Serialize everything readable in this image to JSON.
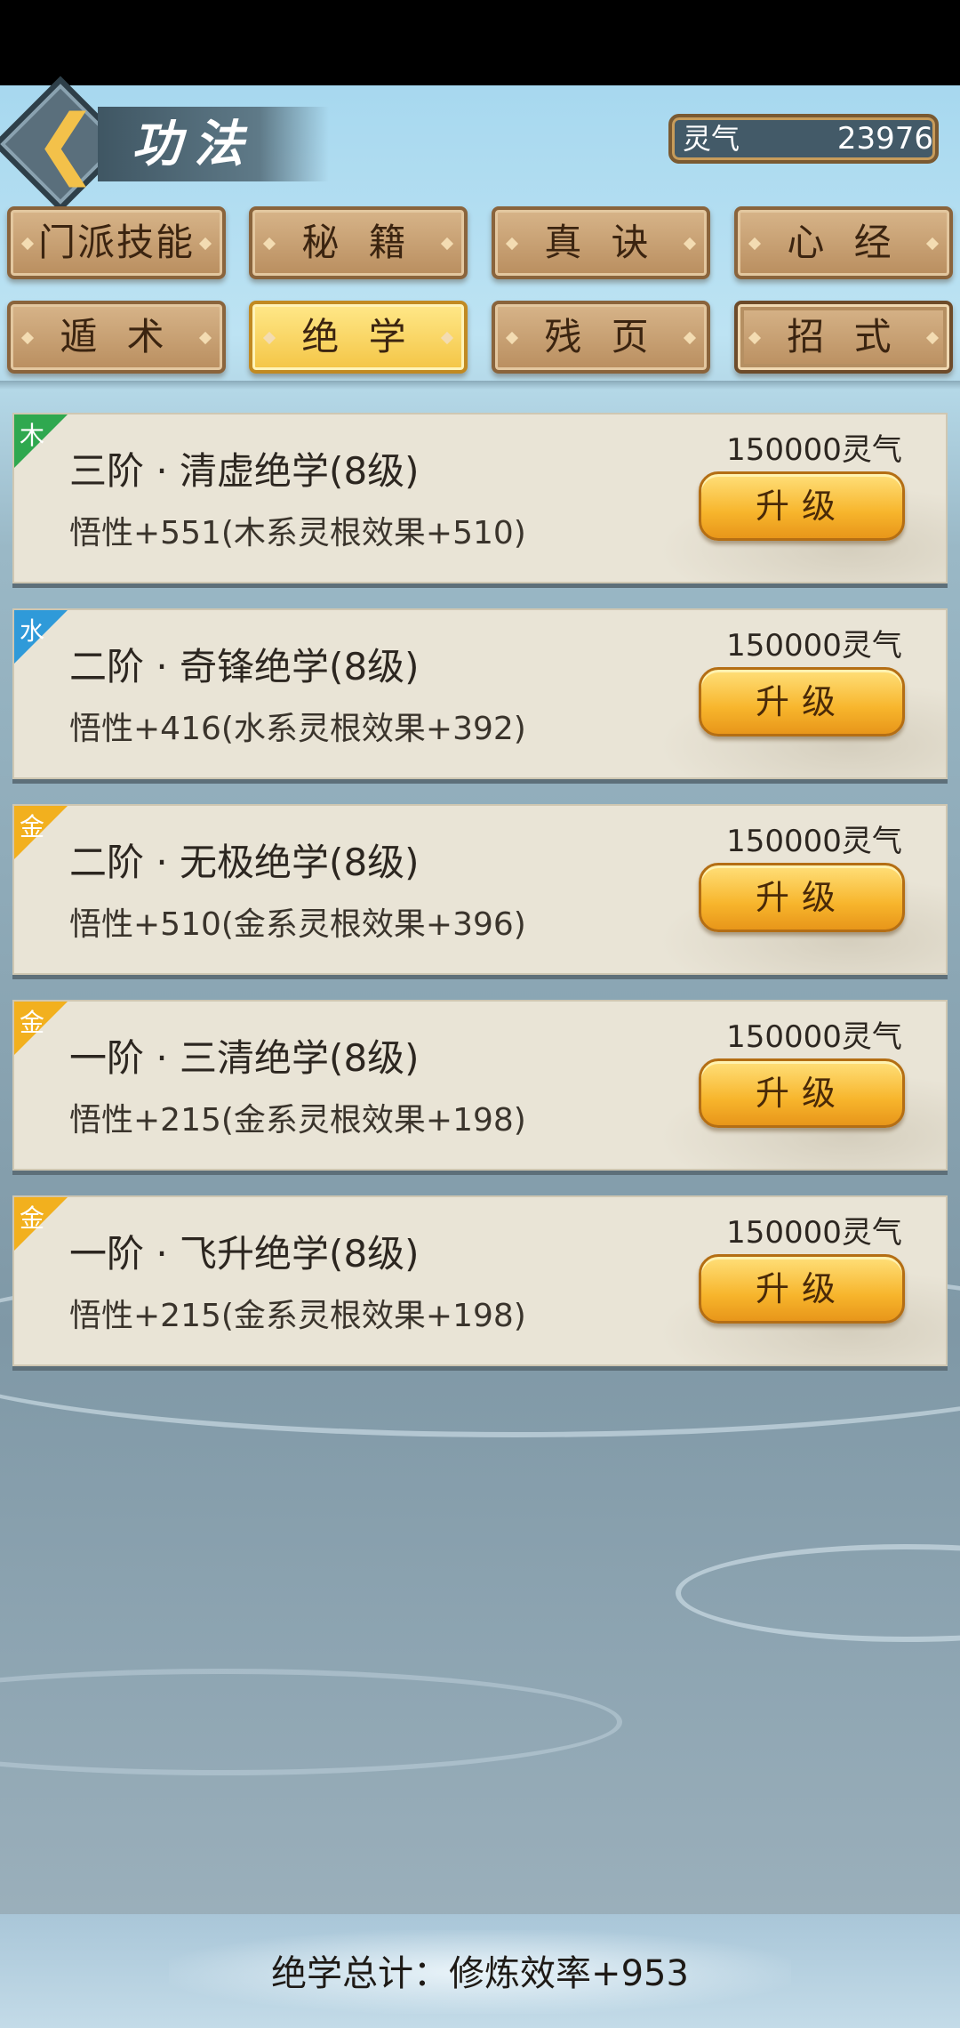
{
  "header": {
    "title": "功法",
    "qi_label": "灵气",
    "qi_value": "23976"
  },
  "tabs_row1": [
    "门派技能",
    "秘 籍",
    "真 诀",
    "心 经"
  ],
  "tabs_row2": [
    "遁 术",
    "绝 学",
    "残 页",
    "招 式"
  ],
  "active_tab": "绝 学",
  "skills": [
    {
      "element": "木",
      "element_color": "#2fa84f",
      "title": "三阶 · 清虚绝学(8级)",
      "stat": "悟性+551(木系灵根效果+510)",
      "cost": "150000灵气",
      "button": "升级"
    },
    {
      "element": "水",
      "element_color": "#2f9ad9",
      "title": "二阶 · 奇锋绝学(8级)",
      "stat": "悟性+416(水系灵根效果+392)",
      "cost": "150000灵气",
      "button": "升级"
    },
    {
      "element": "金",
      "element_color": "#f2b01e",
      "title": "二阶 · 无极绝学(8级)",
      "stat": "悟性+510(金系灵根效果+396)",
      "cost": "150000灵气",
      "button": "升级"
    },
    {
      "element": "金",
      "element_color": "#f2b01e",
      "title": "一阶 · 三清绝学(8级)",
      "stat": "悟性+215(金系灵根效果+198)",
      "cost": "150000灵气",
      "button": "升级"
    },
    {
      "element": "金",
      "element_color": "#f2b01e",
      "title": "一阶 · 飞升绝学(8级)",
      "stat": "悟性+215(金系灵根效果+198)",
      "cost": "150000灵气",
      "button": "升级"
    }
  ],
  "footer": {
    "summary": "绝学总计：修炼效率+953"
  },
  "icons": {
    "back": "chevron-left-icon"
  }
}
